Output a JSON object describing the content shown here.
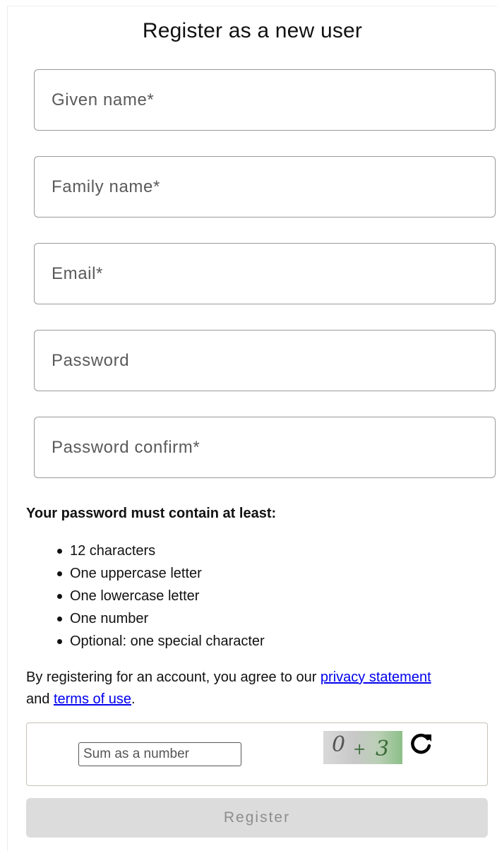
{
  "form": {
    "title": "Register as a new user",
    "fields": [
      {
        "placeholder": "Given name*",
        "value": ""
      },
      {
        "placeholder": "Family name*",
        "value": ""
      },
      {
        "placeholder": "Email*",
        "value": ""
      },
      {
        "placeholder": "Password",
        "value": ""
      },
      {
        "placeholder": "Password confirm*",
        "value": ""
      }
    ]
  },
  "password_rules": {
    "heading": "Your password must contain at least:",
    "items": [
      "12 characters",
      "One uppercase letter",
      "One lowercase letter",
      "One number",
      "Optional: one special character"
    ]
  },
  "agreement": {
    "prefix": "By registering for an account, you agree to our ",
    "privacy_link": "privacy statement",
    "middle": "and ",
    "terms_link": "terms of use",
    "suffix": "."
  },
  "captcha": {
    "placeholder": "Sum as a number",
    "value": "",
    "image_text_a": "0",
    "image_text_op": "+",
    "image_text_b": "3",
    "refresh_icon": "refresh-icon"
  },
  "register_button": {
    "label": "Register",
    "enabled": false
  },
  "colors": {
    "link": "#0000ee",
    "button_bg": "#dcdcdc",
    "button_text": "#8d8d8d",
    "field_border": "#9a9a9a"
  }
}
